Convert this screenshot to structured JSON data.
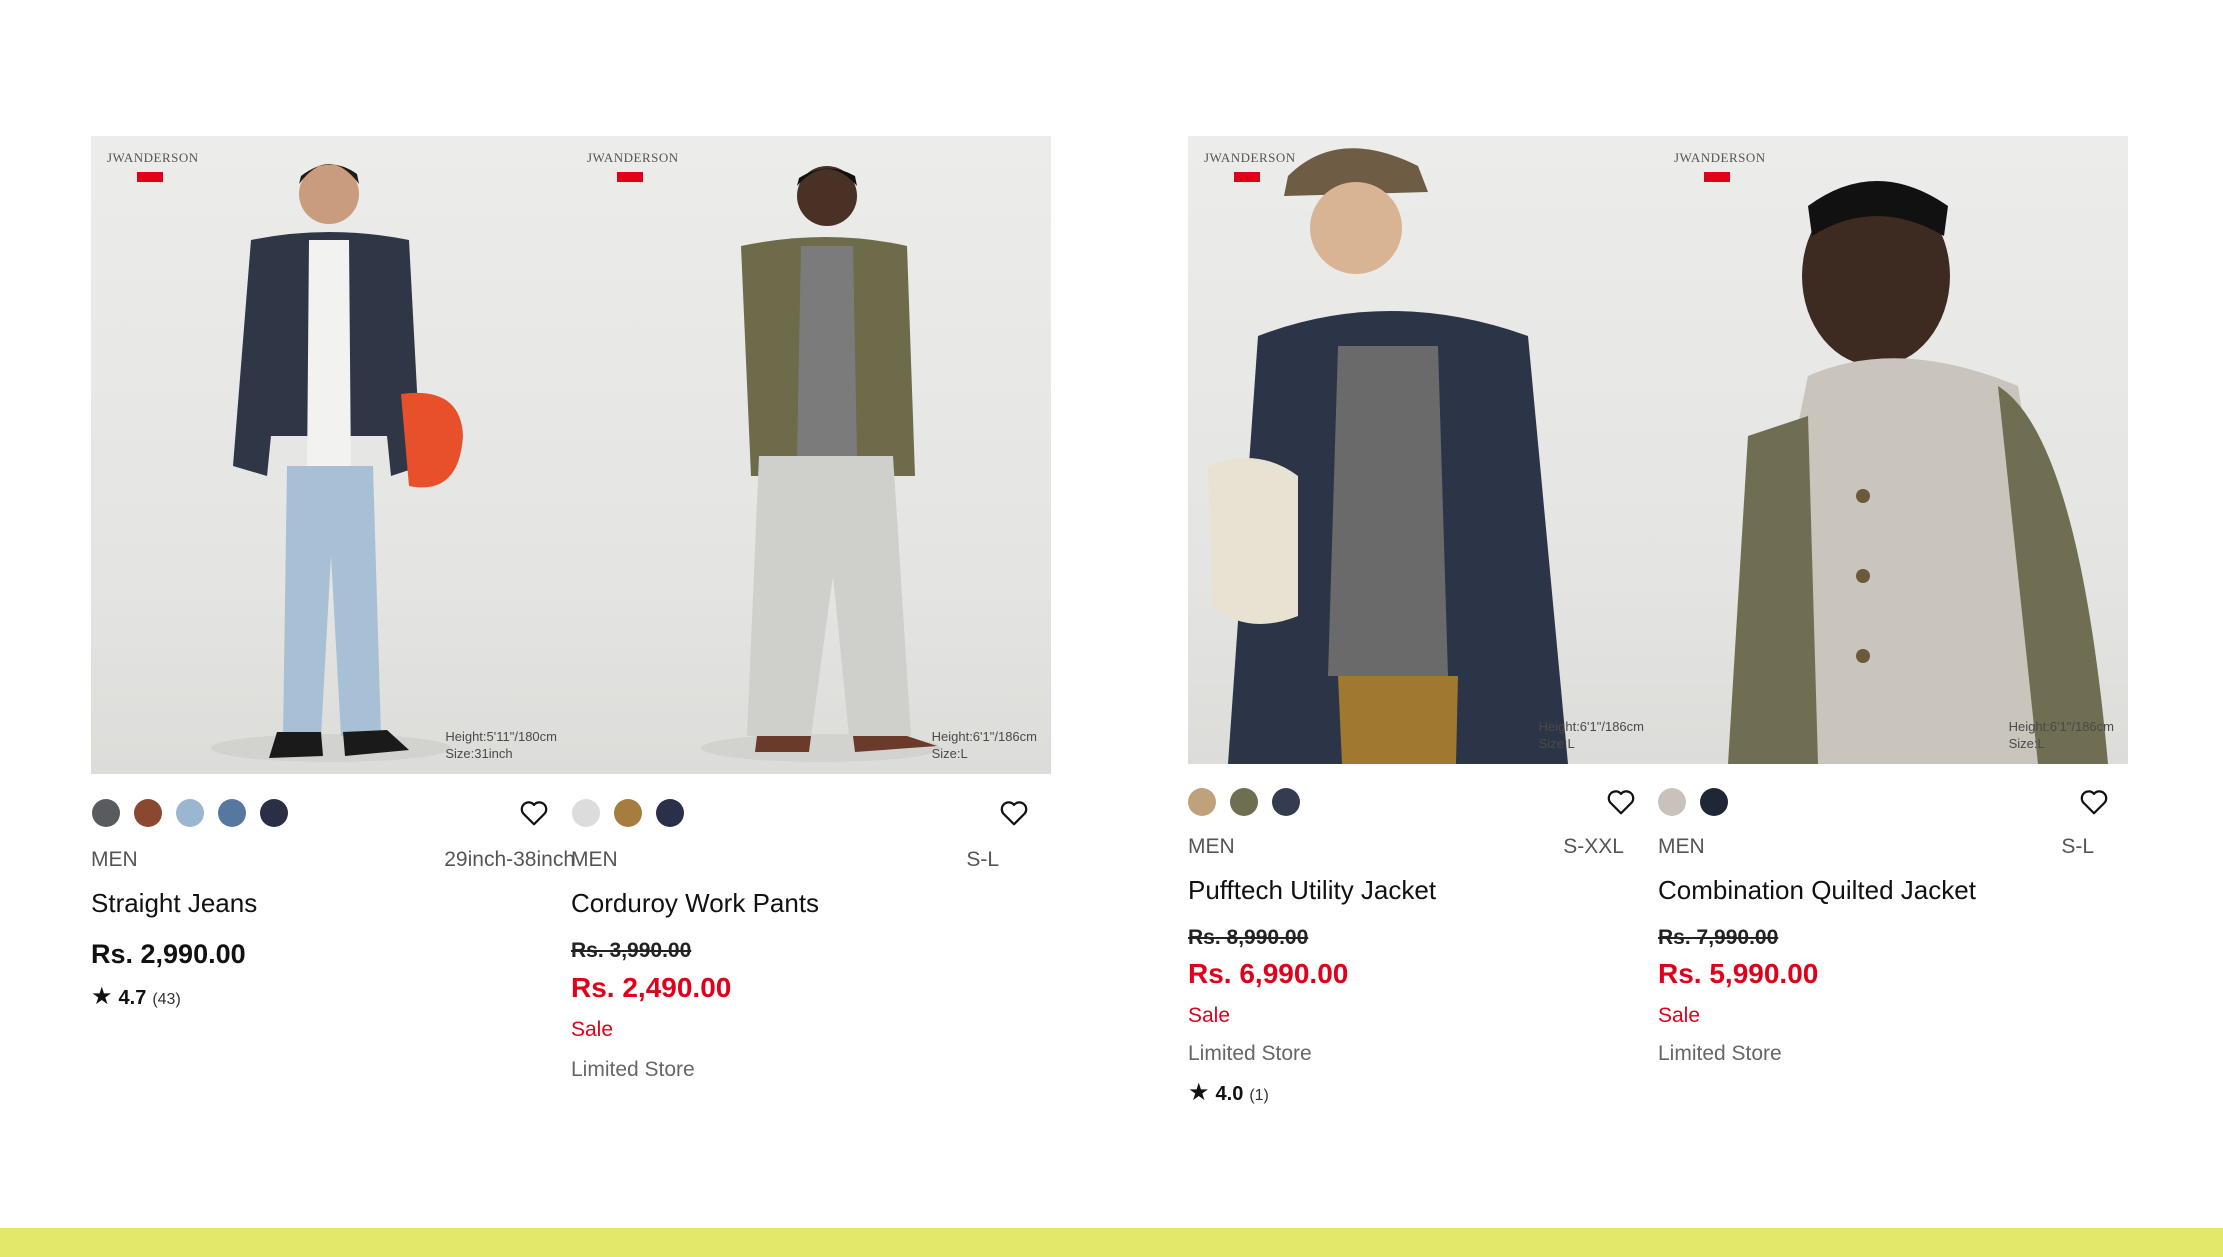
{
  "products": [
    {
      "brand": "JWANDERSON",
      "model_note": [
        "Height:5'11\"/180cm",
        "Size:31inch"
      ],
      "gender": "MEN",
      "size_range": "29inch-38inch",
      "name": "Straight Jeans",
      "price": "Rs. 2,990.00",
      "rating_value": "4.7",
      "rating_count": "(43)",
      "swatches": [
        "#585c5e",
        "#8a4830",
        "#9ab6d0",
        "#5677a0",
        "#2b2f45"
      ]
    },
    {
      "brand": "JWANDERSON",
      "model_note": [
        "Height:6'1\"/186cm",
        "Size:L"
      ],
      "gender": "MEN",
      "size_range": "S-L",
      "name": "Corduroy Work Pants",
      "old_price": "Rs. 3,990.00",
      "sale_price": "Rs. 2,490.00",
      "sale_label": "Sale",
      "store_label": "Limited Store",
      "swatches": [
        "#dcdcdc",
        "#a67c3f",
        "#2a2f4a"
      ]
    },
    {
      "brand": "JWANDERSON",
      "model_note": [
        "Height:6'1\"/186cm",
        "Size:L"
      ],
      "gender": "MEN",
      "size_range": "S-XXL",
      "name": "Pufftech Utility Jacket",
      "old_price": "Rs. 8,990.00",
      "sale_price": "Rs. 6,990.00",
      "sale_label": "Sale",
      "store_label": "Limited Store",
      "rating_value": "4.0",
      "rating_count": "(1)",
      "swatches": [
        "#bfa27c",
        "#6e6f50",
        "#343c4f"
      ]
    },
    {
      "brand": "JWANDERSON",
      "model_note": [
        "Height:6'1\"/186cm",
        "Size:L"
      ],
      "gender": "MEN",
      "size_range": "S-L",
      "name": "Combination Quilted Jacket",
      "old_price": "Rs. 7,990.00",
      "sale_price": "Rs. 5,990.00",
      "sale_label": "Sale",
      "store_label": "Limited Store",
      "swatches": [
        "#c8c2bb",
        "#1f2635"
      ]
    }
  ],
  "colors": {
    "sale_red": "#e0001a",
    "footer_bar": "#e3e86a"
  },
  "icons": {
    "wishlist": "heart-outline-icon",
    "rating": "star-icon"
  }
}
